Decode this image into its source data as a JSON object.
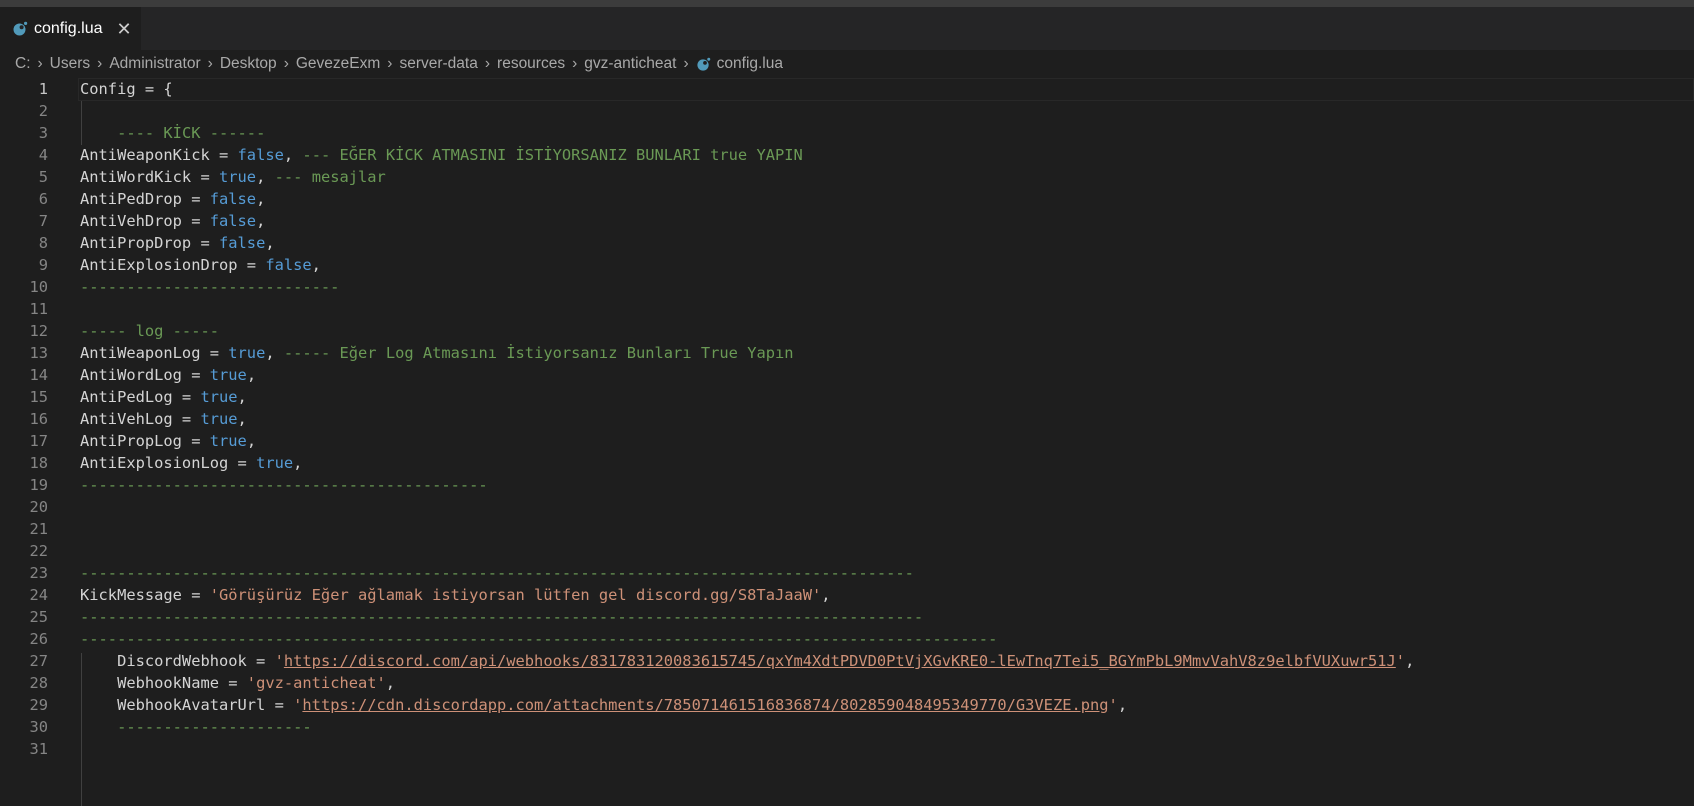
{
  "tab": {
    "title": "config.lua",
    "close": "✕",
    "icon": "lua-file-icon"
  },
  "breadcrumb": {
    "items": [
      "C:",
      "Users",
      "Administrator",
      "Desktop",
      "GevezeExm",
      "server-data",
      "resources",
      "gvz-anticheat"
    ],
    "file": "config.lua",
    "separator": "›"
  },
  "colors": {
    "keyword": "#569cd6",
    "comment": "#6a9955",
    "string": "#ce9178",
    "identifier": "#d4d4d4",
    "background": "#1e1e1e"
  },
  "editor": {
    "active_line": 1,
    "lines": [
      {
        "n": "1",
        "tokens": [
          [
            "id",
            "Config = {"
          ]
        ]
      },
      {
        "n": "2",
        "tokens": []
      },
      {
        "n": "3",
        "tokens": [
          [
            "id",
            "    "
          ],
          [
            "cm",
            "---- KİCK ------"
          ]
        ]
      },
      {
        "n": "4",
        "tokens": [
          [
            "id",
            "AntiWeaponKick = "
          ],
          [
            "kw",
            "false"
          ],
          [
            "id",
            ", "
          ],
          [
            "cm",
            "--- EĞER KİCK ATMASINI İSTİYORSANIZ BUNLARI true YAPIN"
          ]
        ]
      },
      {
        "n": "5",
        "tokens": [
          [
            "id",
            "AntiWordKick = "
          ],
          [
            "kw",
            "true"
          ],
          [
            "id",
            ", "
          ],
          [
            "cm",
            "--- mesajlar"
          ]
        ]
      },
      {
        "n": "6",
        "tokens": [
          [
            "id",
            "AntiPedDrop = "
          ],
          [
            "kw",
            "false"
          ],
          [
            "id",
            ","
          ]
        ]
      },
      {
        "n": "7",
        "tokens": [
          [
            "id",
            "AntiVehDrop = "
          ],
          [
            "kw",
            "false"
          ],
          [
            "id",
            ","
          ]
        ]
      },
      {
        "n": "8",
        "tokens": [
          [
            "id",
            "AntiPropDrop = "
          ],
          [
            "kw",
            "false"
          ],
          [
            "id",
            ","
          ]
        ]
      },
      {
        "n": "9",
        "tokens": [
          [
            "id",
            "AntiExplosionDrop = "
          ],
          [
            "kw",
            "false"
          ],
          [
            "id",
            ","
          ]
        ]
      },
      {
        "n": "10",
        "tokens": [
          [
            "cm",
            "----------------------------"
          ]
        ]
      },
      {
        "n": "11",
        "tokens": []
      },
      {
        "n": "12",
        "tokens": [
          [
            "cm",
            "----- log -----"
          ]
        ]
      },
      {
        "n": "13",
        "tokens": [
          [
            "id",
            "AntiWeaponLog = "
          ],
          [
            "kw",
            "true"
          ],
          [
            "id",
            ", "
          ],
          [
            "cm",
            "----- Eğer Log Atmasını İstiyorsanız Bunları True Yapın"
          ]
        ]
      },
      {
        "n": "14",
        "tokens": [
          [
            "id",
            "AntiWordLog = "
          ],
          [
            "kw",
            "true"
          ],
          [
            "id",
            ","
          ]
        ]
      },
      {
        "n": "15",
        "tokens": [
          [
            "id",
            "AntiPedLog = "
          ],
          [
            "kw",
            "true"
          ],
          [
            "id",
            ","
          ]
        ]
      },
      {
        "n": "16",
        "tokens": [
          [
            "id",
            "AntiVehLog = "
          ],
          [
            "kw",
            "true"
          ],
          [
            "id",
            ","
          ]
        ]
      },
      {
        "n": "17",
        "tokens": [
          [
            "id",
            "AntiPropLog = "
          ],
          [
            "kw",
            "true"
          ],
          [
            "id",
            ","
          ]
        ]
      },
      {
        "n": "18",
        "tokens": [
          [
            "id",
            "AntiExplosionLog = "
          ],
          [
            "kw",
            "true"
          ],
          [
            "id",
            ","
          ]
        ]
      },
      {
        "n": "19",
        "tokens": [
          [
            "cm",
            "--------------------------------------------"
          ]
        ]
      },
      {
        "n": "20",
        "tokens": []
      },
      {
        "n": "21",
        "tokens": []
      },
      {
        "n": "22",
        "tokens": []
      },
      {
        "n": "23",
        "tokens": [
          [
            "cm",
            "------------------------------------------------------------------------------------------"
          ]
        ]
      },
      {
        "n": "24",
        "tokens": [
          [
            "id",
            "KickMessage = "
          ],
          [
            "str",
            "'Görüşürüz Eğer ağlamak istiyorsan lütfen gel discord.gg/S8TaJaaW'"
          ],
          [
            "id",
            ","
          ]
        ]
      },
      {
        "n": "25",
        "tokens": [
          [
            "cm",
            "-------------------------------------------------------------------------------------------"
          ]
        ]
      },
      {
        "n": "26",
        "tokens": [
          [
            "cm",
            "---------------------------------------------------------------------------------------------------"
          ]
        ]
      },
      {
        "n": "27",
        "tokens": [
          [
            "id",
            "    DiscordWebhook = "
          ],
          [
            "str",
            "'"
          ],
          [
            "url",
            "https://discord.com/api/webhooks/831783120083615745/qxYm4XdtPDVD0PtVjXGvKRE0-lEwTnq7Tei5_BGYmPbL9MmvVahV8z9elbfVUXuwr51J"
          ],
          [
            "str",
            "'"
          ],
          [
            "id",
            ","
          ]
        ]
      },
      {
        "n": "28",
        "tokens": [
          [
            "id",
            "    WebhookName = "
          ],
          [
            "str",
            "'gvz-anticheat'"
          ],
          [
            "id",
            ","
          ]
        ]
      },
      {
        "n": "29",
        "tokens": [
          [
            "id",
            "    WebhookAvatarUrl = "
          ],
          [
            "str",
            "'"
          ],
          [
            "url",
            "https://cdn.discordapp.com/attachments/785071461516836874/802859048495349770/G3VEZE.png"
          ],
          [
            "str",
            "'"
          ],
          [
            "id",
            ","
          ]
        ]
      },
      {
        "n": "30",
        "tokens": [
          [
            "id",
            "    "
          ],
          [
            "cm",
            "---------------------"
          ]
        ]
      },
      {
        "n": "31",
        "tokens": []
      }
    ]
  }
}
